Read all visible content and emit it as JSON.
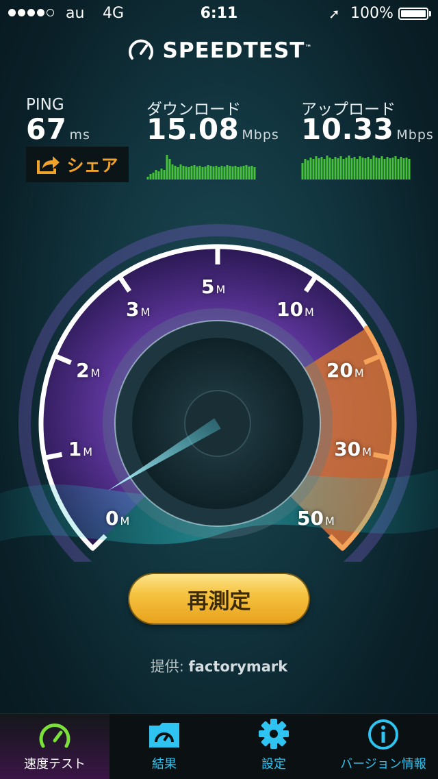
{
  "status_bar": {
    "carrier": "au",
    "network": "4G",
    "time": "6:11",
    "battery": "100%",
    "signal_bars": 5,
    "signal_filled": 4
  },
  "header": {
    "title": "SPEEDTEST",
    "tm": "™"
  },
  "metrics": {
    "ping": {
      "label": "PING",
      "value": "67",
      "unit": "ms"
    },
    "download": {
      "label": "ダウンロード",
      "value": "15.08",
      "unit": "Mbps"
    },
    "upload": {
      "label": "アップロード",
      "value": "10.33",
      "unit": "Mbps"
    }
  },
  "share_label": "シェア",
  "gauge": {
    "ticks": [
      {
        "num": "0",
        "unit": "M"
      },
      {
        "num": "1",
        "unit": "M"
      },
      {
        "num": "2",
        "unit": "M"
      },
      {
        "num": "3",
        "unit": "M"
      },
      {
        "num": "5",
        "unit": "M"
      },
      {
        "num": "10",
        "unit": "M"
      },
      {
        "num": "20",
        "unit": "M"
      },
      {
        "num": "30",
        "unit": "M"
      },
      {
        "num": "50",
        "unit": "M"
      }
    ],
    "needle_value_mbps": 0.4
  },
  "retest_label": "再測定",
  "provider": {
    "prefix": "提供:",
    "name": "factorymark"
  },
  "tabs": [
    {
      "label": "速度テスト",
      "icon": "speedometer-icon",
      "active": true
    },
    {
      "label": "結果",
      "icon": "results-folder-icon",
      "active": false
    },
    {
      "label": "設定",
      "icon": "gear-icon",
      "active": false
    },
    {
      "label": "バージョン情報",
      "icon": "info-icon",
      "active": false
    }
  ],
  "colors": {
    "accent_orange": "#f0a22a",
    "tab_blue": "#2ec3f0",
    "gauge_purple": "#6a3fb0",
    "gauge_orange": "#e07a2a",
    "sparkline_green": "#46c23a"
  }
}
